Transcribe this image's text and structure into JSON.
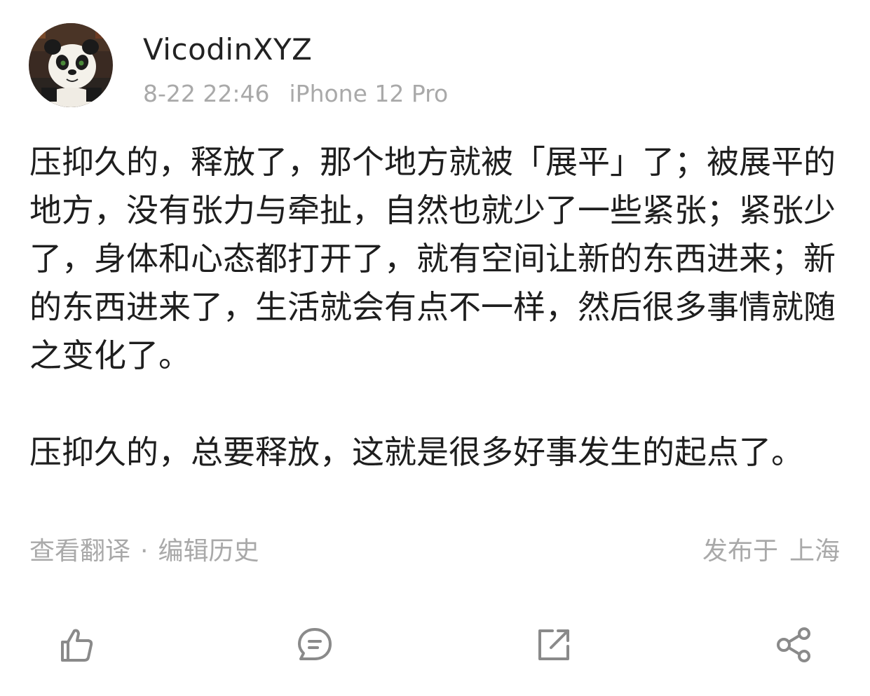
{
  "post": {
    "author": {
      "username": "VicodinXYZ",
      "avatar_desc": "panda-avatar"
    },
    "timestamp": "8-22 22:46",
    "device": "iPhone 12 Pro",
    "paragraphs": [
      "压抑久的，释放了，那个地方就被「展平」了；被展平的地方，没有张力与牵扯，自然也就少了一些紧张；紧张少了，身体和心态都打开了，就有空间让新的东西进来；新的东西进来了，生活就会有点不一样，然后很多事情就随之变化了。",
      "压抑久的，总要释放，这就是很多好事发生的起点了。"
    ],
    "footer": {
      "translate_label": "查看翻译",
      "separator": "·",
      "edit_history_label": "编辑历史",
      "published_prefix": "发布于",
      "location": "上海"
    }
  },
  "actions": [
    {
      "icon": "like-icon"
    },
    {
      "icon": "comment-icon"
    },
    {
      "icon": "repost-icon"
    },
    {
      "icon": "share-icon"
    }
  ],
  "colors": {
    "text_primary": "#1e1e1e",
    "text_secondary": "#a9a9a9",
    "icon_gray": "#8a8a8a",
    "background": "#ffffff"
  }
}
